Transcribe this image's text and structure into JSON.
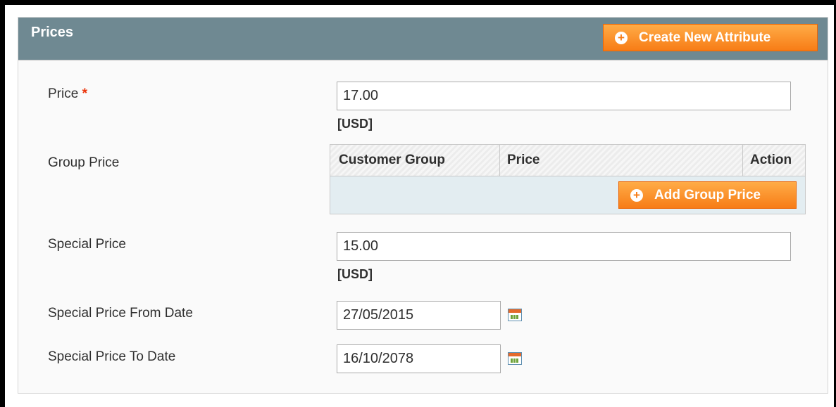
{
  "section": {
    "title": "Prices"
  },
  "buttons": {
    "create_attribute": "Create New Attribute",
    "add_group_price": "Add Group Price"
  },
  "fields": {
    "price": {
      "label": "Price",
      "required_mark": "*",
      "value": "17.00",
      "currency": "[USD]"
    },
    "group_price": {
      "label": "Group Price",
      "columns": [
        "Customer Group",
        "Price",
        "Action"
      ]
    },
    "special_price": {
      "label": "Special Price",
      "value": "15.00",
      "currency": "[USD]"
    },
    "special_from": {
      "label": "Special Price From Date",
      "value": "27/05/2015"
    },
    "special_to": {
      "label": "Special Price To Date",
      "value": "16/10/2078"
    }
  },
  "icons": {
    "add": "plus-circle-icon",
    "calendar": "calendar-icon"
  },
  "colors": {
    "header": "#6f8992",
    "button": "#f77c16",
    "required": "#eb340a",
    "grid_body": "#e3edf1"
  }
}
